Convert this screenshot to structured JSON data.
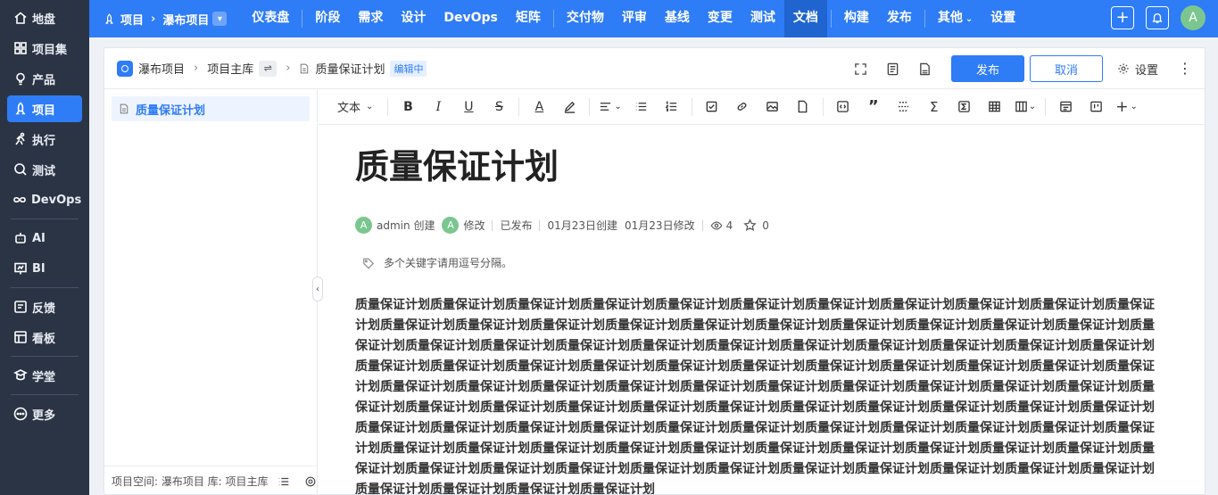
{
  "sidebar": {
    "items": [
      {
        "label": "地盘",
        "icon": "home-icon"
      },
      {
        "label": "项目集",
        "icon": "grid-icon"
      },
      {
        "label": "产品",
        "icon": "bulb-icon"
      },
      {
        "label": "项目",
        "icon": "rocket-icon",
        "active": true
      },
      {
        "label": "执行",
        "icon": "run-icon"
      },
      {
        "label": "测试",
        "icon": "search-icon"
      },
      {
        "label": "DevOps",
        "icon": "infinity-icon"
      },
      {
        "label": "AI",
        "icon": "robot-icon"
      },
      {
        "label": "BI",
        "icon": "chart-icon"
      },
      {
        "label": "反馈",
        "icon": "feedback-icon"
      },
      {
        "label": "看板",
        "icon": "board-icon"
      },
      {
        "label": "学堂",
        "icon": "school-icon"
      },
      {
        "label": "更多",
        "icon": "more-icon"
      }
    ]
  },
  "topbar": {
    "crumb_root": "项目",
    "crumb_project": "瀑布项目",
    "nav": [
      "仪表盘",
      "阶段",
      "需求",
      "设计",
      "DevOps",
      "矩阵",
      "交付物",
      "评审",
      "基线",
      "变更",
      "测试",
      "文档",
      "构建",
      "发布",
      "其他",
      "设置"
    ],
    "active_nav": "文档",
    "avatar": "A"
  },
  "header": {
    "space": "瀑布项目",
    "lib": "项目主库",
    "doc": "质量保证计划",
    "status_tag": "编辑中",
    "publish": "发布",
    "cancel": "取消",
    "settings": "设置"
  },
  "tree": {
    "item": "质量保证计划",
    "footer": "项目空间: 瀑布项目 库: 项目主库"
  },
  "toolbar": {
    "text_style": "文本"
  },
  "doc": {
    "title": "质量保证计划",
    "author": "admin",
    "created_word": "创建",
    "modified_word": "修改",
    "status": "已发布",
    "created_date": "01月23日创建",
    "modified_date": "01月23日修改",
    "views": "4",
    "stars": "0",
    "keywords_placeholder": "多个关键字请用逗号分隔。",
    "body_phrase": "质量保证计划",
    "body_repeat": 100
  }
}
